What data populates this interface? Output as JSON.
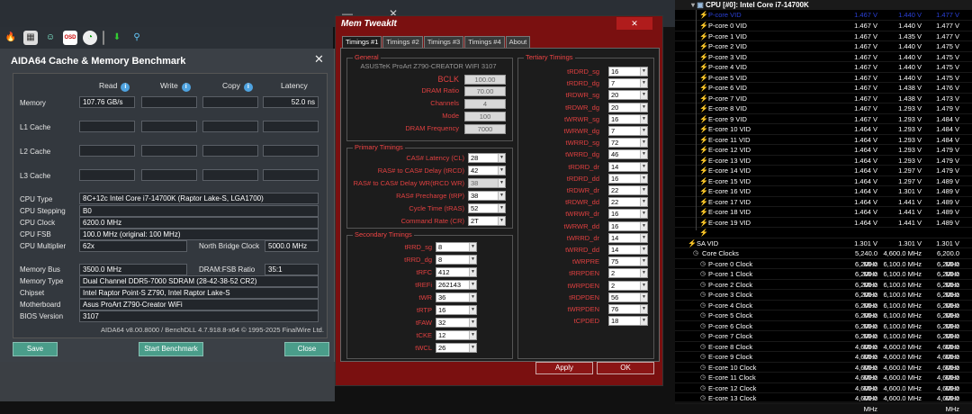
{
  "aida": {
    "title": "AIDA64 Cache & Memory Benchmark",
    "close": "✕",
    "headers": {
      "read": "Read",
      "write": "Write",
      "copy": "Copy",
      "latency": "Latency"
    },
    "rows": [
      {
        "label": "Memory",
        "read": "107.76 GB/s",
        "write": "",
        "copy": "",
        "latency": "52.0 ns"
      },
      {
        "label": "L1 Cache",
        "read": "",
        "write": "",
        "copy": "",
        "latency": ""
      },
      {
        "label": "L2 Cache",
        "read": "",
        "write": "",
        "copy": "",
        "latency": ""
      },
      {
        "label": "L3 Cache",
        "read": "",
        "write": "",
        "copy": "",
        "latency": ""
      }
    ],
    "cpu_type_label": "CPU Type",
    "cpu_type": "8C+12c Intel Core i7-14700K  (Raptor Lake-S, LGA1700)",
    "cpu_stepping_label": "CPU Stepping",
    "cpu_stepping": "B0",
    "cpu_clock_label": "CPU Clock",
    "cpu_clock": "6200.0 MHz",
    "cpu_fsb_label": "CPU FSB",
    "cpu_fsb": "100.0 MHz  (original: 100 MHz)",
    "cpu_mult_label": "CPU Multiplier",
    "cpu_mult": "62x",
    "nb_clock_label": "North Bridge Clock",
    "nb_clock": "5000.0 MHz",
    "mem_bus_label": "Memory Bus",
    "mem_bus": "3500.0 MHz",
    "dram_fsb_label": "DRAM:FSB Ratio",
    "dram_fsb": "35:1",
    "mem_type_label": "Memory Type",
    "mem_type": "Dual Channel DDR5-7000 SDRAM  (28-42-38-52 CR2)",
    "chipset_label": "Chipset",
    "chipset": "Intel Raptor Point-S Z790, Intel Raptor Lake-S",
    "mobo_label": "Motherboard",
    "mobo": "Asus ProArt Z790-Creator WiFi",
    "bios_label": "BIOS Version",
    "bios": "3107",
    "footer": "AIDA64 v8.00.8000 / BenchDLL 4.7.918.8-x64  © 1995-2025 FinalWire Ltd.",
    "save": "Save",
    "start": "Start Benchmark",
    "close_btn": "Close"
  },
  "mtw": {
    "title": "Mem TweakIt",
    "close": "✕",
    "tabs": [
      "Timings #1",
      "Timings #2",
      "Timings #3",
      "Timings #4",
      "About"
    ],
    "general_title": "General",
    "board": "ASUSTeK ProArt Z790-CREATOR WIFI 3107",
    "general": [
      {
        "label": "BCLK",
        "value": "100.00"
      },
      {
        "label": "DRAM Ratio",
        "value": "70.00"
      },
      {
        "label": "Channels",
        "value": "4"
      },
      {
        "label": "Mode",
        "value": "100"
      },
      {
        "label": "DRAM Frequency",
        "value": "7000"
      }
    ],
    "primary_title": "Primary Timings",
    "primary": [
      {
        "label": "CAS# Latency (CL)",
        "value": "28"
      },
      {
        "label": "RAS# to CAS# Delay (tRCD)",
        "value": "42"
      },
      {
        "label": "RAS# to CAS# Delay WR(tRCD WR)",
        "value": "38"
      },
      {
        "label": "RAS# Precharge (tRP)",
        "value": "38"
      },
      {
        "label": "Cycle Time (tRAS)",
        "value": "52"
      },
      {
        "label": "Command Rate (CR)",
        "value": "2T"
      }
    ],
    "secondary_title": "Secondary Timings",
    "secondary": [
      {
        "label": "tRRD_sg",
        "value": "8"
      },
      {
        "label": "tRRD_dg",
        "value": "8"
      },
      {
        "label": "tRFC",
        "value": "412"
      },
      {
        "label": "tREFi",
        "value": "262143"
      },
      {
        "label": "tWR",
        "value": "36"
      },
      {
        "label": "tRTP",
        "value": "16"
      },
      {
        "label": "tFAW",
        "value": "32"
      },
      {
        "label": "tCKE",
        "value": "12"
      },
      {
        "label": "tWCL",
        "value": "26"
      }
    ],
    "tertiary_title": "Tertiary Timings",
    "tertiary": [
      {
        "label": "tRDRD_sg",
        "value": "16"
      },
      {
        "label": "tRDRD_dg",
        "value": "7"
      },
      {
        "label": "tRDWR_sg",
        "value": "20"
      },
      {
        "label": "tRDWR_dg",
        "value": "20"
      },
      {
        "label": "tWRWR_sg",
        "value": "16"
      },
      {
        "label": "tWRWR_dg",
        "value": "7"
      },
      {
        "label": "tWRRD_sg",
        "value": "72"
      },
      {
        "label": "tWRRD_dg",
        "value": "46"
      },
      {
        "label": "tRDRD_dr",
        "value": "14"
      },
      {
        "label": "tRDRD_dd",
        "value": "16"
      },
      {
        "label": "tRDWR_dr",
        "value": "22"
      },
      {
        "label": "tRDWR_dd",
        "value": "22"
      },
      {
        "label": "tWRWR_dr",
        "value": "16"
      },
      {
        "label": "tWRWR_dd",
        "value": "16"
      },
      {
        "label": "tWRRD_dr",
        "value": "14"
      },
      {
        "label": "tWRRD_dd",
        "value": "14"
      },
      {
        "label": "tWRPRE",
        "value": "75"
      },
      {
        "label": "tRRPDEN",
        "value": "2"
      },
      {
        "label": "tWRPDEN",
        "value": "2"
      },
      {
        "label": "tRDPDEN",
        "value": "56"
      },
      {
        "label": "tWRPDEN",
        "value": "76"
      },
      {
        "label": "tCPDED",
        "value": "18"
      }
    ],
    "apply": "Apply",
    "ok": "OK"
  },
  "hw": {
    "header": "CPU [#0]: Intel Core i7-14700K",
    "rows": [
      {
        "name": "P-core 0 VID",
        "a": "1.467 V",
        "b": "1.440 V",
        "c": "1.477 V"
      },
      {
        "name": "P-core 1 VID",
        "a": "1.467 V",
        "b": "1.435 V",
        "c": "1.477 V"
      },
      {
        "name": "P-core 2 VID",
        "a": "1.467 V",
        "b": "1.440 V",
        "c": "1.475 V"
      },
      {
        "name": "P-core 3 VID",
        "a": "1.467 V",
        "b": "1.440 V",
        "c": "1.475 V"
      },
      {
        "name": "P-core 4 VID",
        "a": "1.467 V",
        "b": "1.440 V",
        "c": "1.475 V"
      },
      {
        "name": "P-core 5 VID",
        "a": "1.467 V",
        "b": "1.440 V",
        "c": "1.475 V"
      },
      {
        "name": "P-core 6 VID",
        "a": "1.467 V",
        "b": "1.438 V",
        "c": "1.476 V"
      },
      {
        "name": "P-core 7 VID",
        "a": "1.467 V",
        "b": "1.438 V",
        "c": "1.473 V"
      },
      {
        "name": "E-core 8 VID",
        "a": "1.467 V",
        "b": "1.293 V",
        "c": "1.479 V"
      },
      {
        "name": "E-core 9 VID",
        "a": "1.467 V",
        "b": "1.293 V",
        "c": "1.484 V"
      },
      {
        "name": "E-core 10 VID",
        "a": "1.464 V",
        "b": "1.293 V",
        "c": "1.484 V"
      },
      {
        "name": "E-core 11 VID",
        "a": "1.464 V",
        "b": "1.293 V",
        "c": "1.484 V"
      },
      {
        "name": "E-core 12 VID",
        "a": "1.464 V",
        "b": "1.293 V",
        "c": "1.479 V"
      },
      {
        "name": "E-core 13 VID",
        "a": "1.464 V",
        "b": "1.293 V",
        "c": "1.479 V"
      },
      {
        "name": "E-core 14 VID",
        "a": "1.464 V",
        "b": "1.297 V",
        "c": "1.479 V"
      },
      {
        "name": "E-core 15 VID",
        "a": "1.464 V",
        "b": "1.297 V",
        "c": "1.489 V"
      },
      {
        "name": "E-core 16 VID",
        "a": "1.464 V",
        "b": "1.301 V",
        "c": "1.489 V"
      },
      {
        "name": "E-core 17 VID",
        "a": "1.464 V",
        "b": "1.441 V",
        "c": "1.489 V"
      },
      {
        "name": "E-core 18 VID",
        "a": "1.464 V",
        "b": "1.441 V",
        "c": "1.489 V"
      },
      {
        "name": "E-core 19 VID",
        "a": "1.464 V",
        "b": "1.441 V",
        "c": "1.489 V"
      },
      {
        "name": "",
        "a": "",
        "b": "",
        "c": ""
      },
      {
        "name": "SA VID",
        "a": "1.301 V",
        "b": "1.301 V",
        "c": "1.301 V"
      },
      {
        "name": "Core Clocks",
        "a": "5,240.0 MHz",
        "b": "4,600.0 MHz",
        "c": "6,200.0 MHz"
      },
      {
        "name": "P-core 0 Clock",
        "a": "6,200.0 MHz",
        "b": "6,100.0 MHz",
        "c": "6,200.0 MHz"
      },
      {
        "name": "P-core 1 Clock",
        "a": "6,200.0 MHz",
        "b": "6,100.0 MHz",
        "c": "6,200.0 MHz"
      },
      {
        "name": "P-core 2 Clock",
        "a": "6,200.0 MHz",
        "b": "6,100.0 MHz",
        "c": "6,200.0 MHz"
      },
      {
        "name": "P-core 3 Clock",
        "a": "6,200.0 MHz",
        "b": "6,100.0 MHz",
        "c": "6,200.0 MHz"
      },
      {
        "name": "P-core 4 Clock",
        "a": "6,200.0 MHz",
        "b": "6,100.0 MHz",
        "c": "6,200.0 MHz"
      },
      {
        "name": "P-core 5 Clock",
        "a": "6,200.0 MHz",
        "b": "6,100.0 MHz",
        "c": "6,200.0 MHz"
      },
      {
        "name": "P-core 6 Clock",
        "a": "6,200.0 MHz",
        "b": "6,100.0 MHz",
        "c": "6,200.0 MHz"
      },
      {
        "name": "P-core 7 Clock",
        "a": "6,200.0 MHz",
        "b": "6,100.0 MHz",
        "c": "6,200.0 MHz"
      },
      {
        "name": "E-core 8 Clock",
        "a": "4,600.0 MHz",
        "b": "4,600.0 MHz",
        "c": "4,600.0 MHz"
      },
      {
        "name": "E-core 9 Clock",
        "a": "4,600.0 MHz",
        "b": "4,600.0 MHz",
        "c": "4,600.0 MHz"
      },
      {
        "name": "E-core 10 Clock",
        "a": "4,600.0 MHz",
        "b": "4,600.0 MHz",
        "c": "4,600.0 MHz"
      },
      {
        "name": "E-core 11 Clock",
        "a": "4,600.0 MHz",
        "b": "4,600.0 MHz",
        "c": "4,600.0 MHz"
      },
      {
        "name": "E-core 12 Clock",
        "a": "4,600.0 MHz",
        "b": "4,600.0 MHz",
        "c": "4,600.0 MHz"
      },
      {
        "name": "E-core 13 Clock",
        "a": "4,600.0 MHz",
        "b": "4,600.0 MHz",
        "c": "4,600.0 MHz"
      }
    ]
  }
}
